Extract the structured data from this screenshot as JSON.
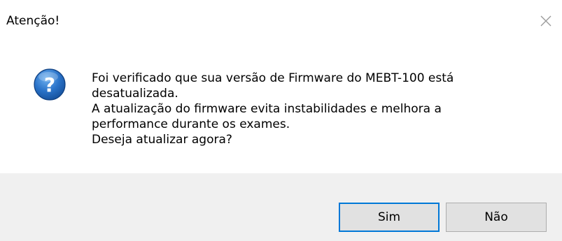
{
  "dialog": {
    "title": "Atenção!",
    "message_lines": [
      "Foi verificado que sua versão de Firmware do MEBT-100 está",
      "desatualizada.",
      "A atualização do firmware evita instabilidades e melhora a",
      "performance durante os exames.",
      "Deseja atualizar agora?"
    ],
    "buttons": {
      "yes_label": "Sim",
      "no_label": "Não"
    },
    "icons": {
      "message_icon": "question-icon",
      "close_icon": "close-icon"
    },
    "colors": {
      "footer_bg": "#f0f0f0",
      "default_button_border": "#0078d7",
      "icon_blue": "#1e63b8"
    }
  }
}
